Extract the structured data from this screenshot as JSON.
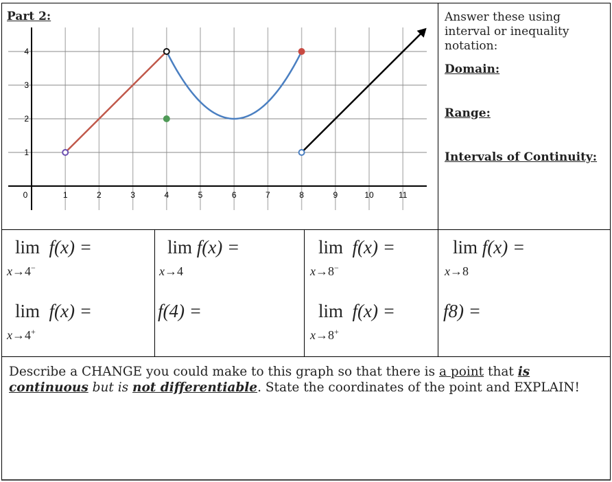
{
  "part_title": "Part 2:",
  "instructions": "Answer these using interval or inequality notation:",
  "prompts": {
    "domain": "Domain:",
    "range": "Range:",
    "continuity": "Intervals of Continuity:"
  },
  "graph": {
    "x_ticks": [
      "0",
      "1",
      "2",
      "3",
      "4",
      "5",
      "6",
      "7",
      "8",
      "9",
      "10",
      "11"
    ],
    "y_ticks": [
      "1",
      "2",
      "3",
      "4"
    ],
    "pieces": [
      {
        "kind": "line",
        "from": [
          1,
          1
        ],
        "to": [
          4,
          4
        ],
        "color": "#c0584a"
      },
      {
        "kind": "parabola",
        "vertex": [
          6,
          2
        ],
        "from_x": 4,
        "to_x": 8,
        "color": "#4a7fc1"
      },
      {
        "kind": "ray",
        "from": [
          8,
          1
        ],
        "through": [
          11.7,
          4.7
        ],
        "color": "#000000"
      }
    ],
    "points": [
      {
        "x": 1,
        "y": 1,
        "open": true,
        "color": "#6b4fb0"
      },
      {
        "x": 4,
        "y": 4,
        "open": true,
        "color": "#111111"
      },
      {
        "x": 4,
        "y": 2,
        "open": false,
        "color": "#4f9a57"
      },
      {
        "x": 8,
        "y": 4,
        "open": false,
        "color": "#c84a42"
      },
      {
        "x": 8,
        "y": 1,
        "open": true,
        "color": "#4a7fc1"
      }
    ]
  },
  "limits": {
    "lim": "lim",
    "fx": "f(x) =",
    "c1r1": {
      "sub_var": "x",
      "arrow": "→",
      "val": "4",
      "side": "−"
    },
    "c2r1": {
      "sub_var": "x",
      "arrow": "→",
      "val": "4",
      "side": ""
    },
    "c3r1": {
      "sub_var": "x",
      "arrow": "→",
      "val": "8",
      "side": "−"
    },
    "c4r1": {
      "sub_var": "x",
      "arrow": "→",
      "val": "8",
      "side": ""
    },
    "c1r2": {
      "sub_var": "x",
      "arrow": "→",
      "val": "4",
      "side": "+"
    },
    "c2r2_text": "f(4) =",
    "c3r2": {
      "sub_var": "x",
      "arrow": "→",
      "val": "8",
      "side": "+"
    },
    "c4r2_text": "f8) ="
  },
  "description": {
    "p1": "Describe a CHANGE you could make to this graph so that there is ",
    "u1": "a point",
    "p2": " that ",
    "b1": "is continuous",
    "p3": " but is ",
    "b2": "not differentiable",
    "p4": ".  State the coordinates of the point and EXPLAIN!"
  }
}
